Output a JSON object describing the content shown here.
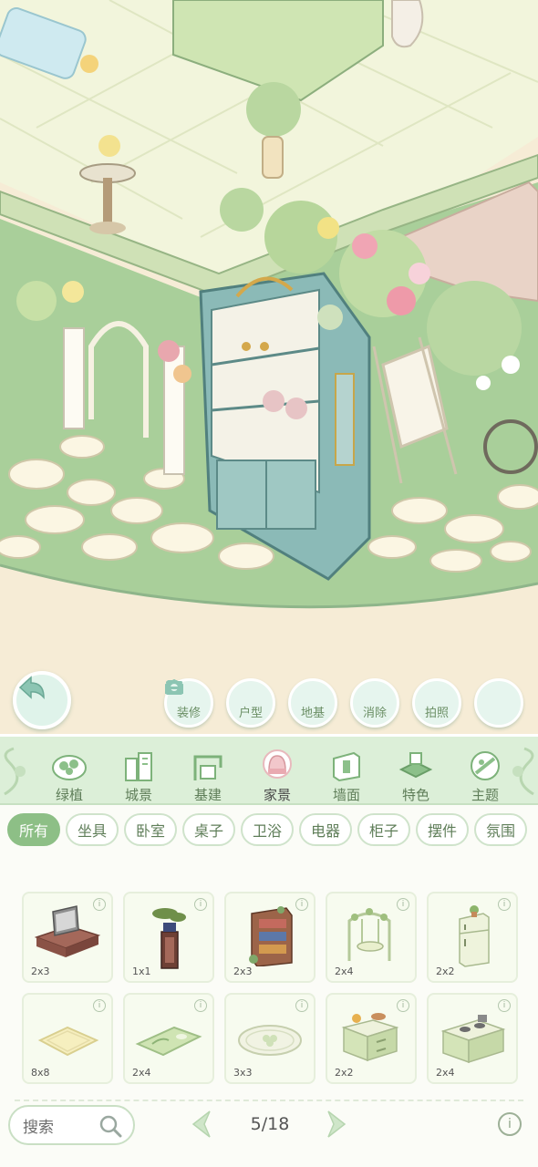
{
  "tools": [
    {
      "name": "decorate-button",
      "label": "装修",
      "icon": "hammer-icon"
    },
    {
      "name": "house-type-button",
      "label": "户型",
      "icon": "house-layout-icon"
    },
    {
      "name": "foundation-button",
      "label": "地基",
      "icon": "foundation-icon"
    },
    {
      "name": "clear-button",
      "label": "消除",
      "icon": "eraser-icon"
    },
    {
      "name": "photo-button",
      "label": "拍照",
      "icon": "camera-icon"
    }
  ],
  "categories": [
    {
      "label": "绿植",
      "icon": "plant-icon"
    },
    {
      "label": "城景",
      "icon": "city-icon"
    },
    {
      "label": "基建",
      "icon": "construction-icon"
    },
    {
      "label": "家景",
      "icon": "chair-icon",
      "active": true
    },
    {
      "label": "墙面",
      "icon": "wall-icon"
    },
    {
      "label": "特色",
      "icon": "special-icon"
    },
    {
      "label": "主题",
      "icon": "theme-icon"
    }
  ],
  "subtabs": [
    "所有",
    "坐具",
    "卧室",
    "桌子",
    "卫浴",
    "电器",
    "柜子",
    "摆件",
    "氛围"
  ],
  "active_subtab": "所有",
  "items": [
    {
      "size": "2x3",
      "icon": "tv-cabinet-icon"
    },
    {
      "size": "1x1",
      "icon": "bonsai-stand-icon"
    },
    {
      "size": "2x3",
      "icon": "bookshelf-icon"
    },
    {
      "size": "2x4",
      "icon": "swing-chair-icon"
    },
    {
      "size": "2x2",
      "icon": "fridge-icon"
    },
    {
      "size": "8x8",
      "icon": "floor-rug-icon"
    },
    {
      "size": "2x4",
      "icon": "leaf-rug-icon"
    },
    {
      "size": "3x3",
      "icon": "round-rug-icon"
    },
    {
      "size": "2x2",
      "icon": "kitchen-cabinet-icon"
    },
    {
      "size": "2x4",
      "icon": "stove-counter-icon"
    }
  ],
  "info_glyph": "i",
  "search": {
    "placeholder": "搜索"
  },
  "pager": {
    "text": "5/18"
  },
  "colors": {
    "accent": "#8dbf86",
    "panel": "#dcefd8",
    "tool_bg": "#e6f5ee",
    "scene_grass": "#a9cf9a"
  }
}
